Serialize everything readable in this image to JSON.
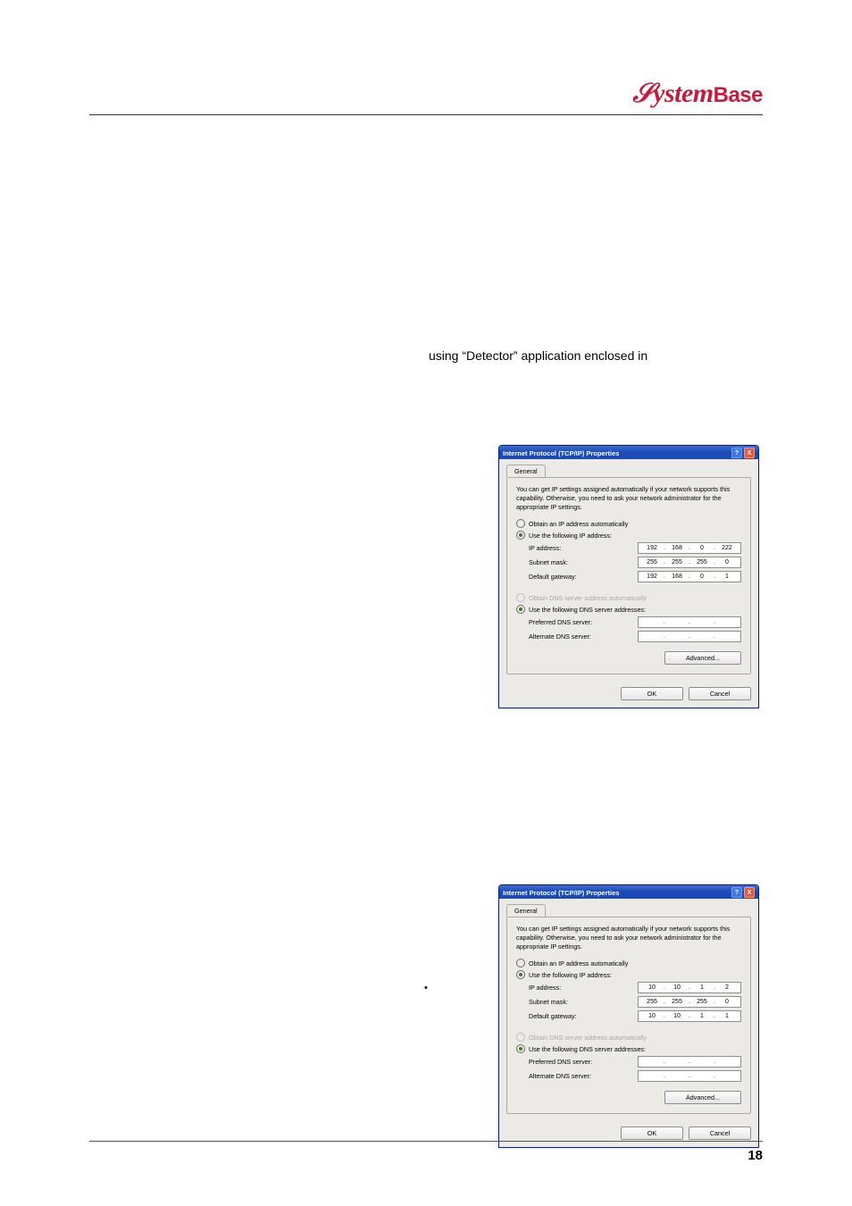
{
  "branding": {
    "logo_text": "SystemBase"
  },
  "body": {
    "line1": "using “Detector” application enclosed in",
    "bullet": "•"
  },
  "dialog": {
    "title": "Internet Protocol (TCP/IP) Properties",
    "help_title": "?",
    "close_title": "X",
    "tab_general": "General",
    "description": "You can get IP settings assigned automatically if your network supports this capability. Otherwise, you need to ask your network administrator for the appropriate IP settings.",
    "radio_obtain_ip": "Obtain an IP address automatically",
    "radio_use_ip": "Use the following IP address:",
    "label_ip": "IP address:",
    "label_subnet": "Subnet mask:",
    "label_gateway": "Default gateway:",
    "radio_obtain_dns": "Obtain DNS server address automatically",
    "radio_use_dns": "Use the following DNS server addresses:",
    "label_pref_dns": "Preferred DNS server:",
    "label_alt_dns": "Alternate DNS server:",
    "btn_advanced": "Advanced...",
    "btn_ok": "OK",
    "btn_cancel": "Cancel"
  },
  "net1": {
    "ip": [
      "192",
      "168",
      "0",
      "222"
    ],
    "subnet": [
      "255",
      "255",
      "255",
      "0"
    ],
    "gateway": [
      "192",
      "168",
      "0",
      "1"
    ],
    "pref_dns": [
      "",
      "",
      "",
      ""
    ],
    "alt_dns": [
      "",
      "",
      "",
      ""
    ]
  },
  "net2": {
    "ip": [
      "10",
      "10",
      "1",
      "2"
    ],
    "subnet": [
      "255",
      "255",
      "255",
      "0"
    ],
    "gateway": [
      "10",
      "10",
      "1",
      "1"
    ],
    "pref_dns": [
      "",
      "",
      "",
      ""
    ],
    "alt_dns": [
      "",
      "",
      "",
      ""
    ]
  },
  "footer": {
    "page": "18"
  }
}
